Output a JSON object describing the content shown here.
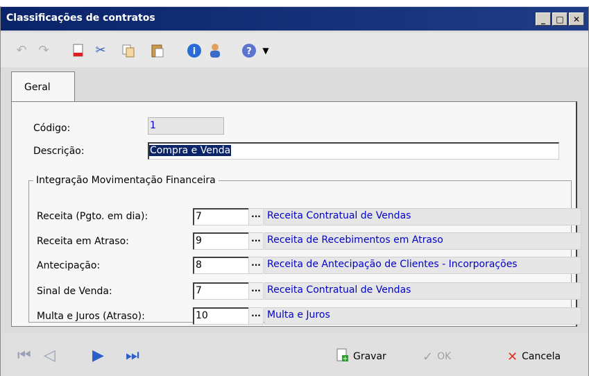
{
  "window": {
    "title": "Classificações de contratos",
    "controls": [
      "_",
      "□",
      "✕"
    ]
  },
  "toolbar": {
    "icons": [
      "undo-icon",
      "redo-icon",
      "new-document-icon",
      "cut-icon",
      "copy-icon",
      "paste-icon",
      "info-icon",
      "user-icon",
      "help-icon",
      "dropdown-arrow-icon"
    ]
  },
  "tabs": [
    {
      "label": "Geral"
    }
  ],
  "form": {
    "codigo_label": "Código:",
    "codigo_value": "1",
    "descricao_label": "Descrição:",
    "descricao_value": "Compra e Venda"
  },
  "group": {
    "legend": "Integração Movimentação Financeira",
    "rows": [
      {
        "label": "Receita (Pgto. em dia):",
        "code": "7",
        "description": "Receita Contratual de Vendas"
      },
      {
        "label": "Receita em Atraso:",
        "code": "9",
        "description": "Receita de Recebimentos em Atraso"
      },
      {
        "label": "Antecipação:",
        "code": "8",
        "description": "Receita de Antecipação de Clientes - Incorporações"
      },
      {
        "label": "Sinal de Venda:",
        "code": "7",
        "description": "Receita Contratual de Vendas"
      },
      {
        "label": "Multa e Juros (Atraso):",
        "code": "10",
        "description": "Multa e Juros"
      }
    ],
    "ellipsis": "···"
  },
  "footer": {
    "gravar": "Gravar",
    "ok": "OK",
    "cancela": "Cancela"
  },
  "colors": {
    "titlebar": "#0a246a",
    "link_text": "#0000cc",
    "selection": "#0a246a"
  }
}
